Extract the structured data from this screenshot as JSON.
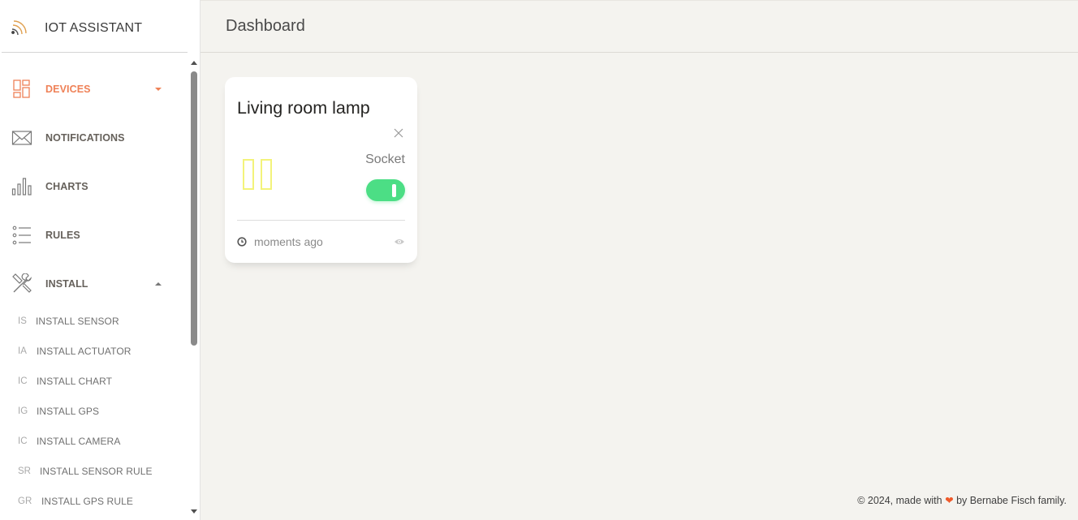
{
  "app": {
    "name": "IOT ASSISTANT"
  },
  "colors": {
    "accent": "#ef8157",
    "toggle_on": "#4cde85",
    "lamp_icon": "#f3f37a"
  },
  "sidebar": {
    "items": [
      {
        "label": "DEVICES",
        "icon": "dashboard-grid-icon",
        "active": true,
        "caret": "down"
      },
      {
        "label": "NOTIFICATIONS",
        "icon": "envelope-icon"
      },
      {
        "label": "CHARTS",
        "icon": "bar-chart-icon"
      },
      {
        "label": "RULES",
        "icon": "list-icon"
      },
      {
        "label": "INSTALL",
        "icon": "tools-icon",
        "caret": "up"
      }
    ],
    "install_items": [
      {
        "abbr": "IS",
        "label": "INSTALL SENSOR"
      },
      {
        "abbr": "IA",
        "label": "INSTALL ACTUATOR"
      },
      {
        "abbr": "IC",
        "label": "INSTALL CHART"
      },
      {
        "abbr": "IG",
        "label": "INSTALL GPS"
      },
      {
        "abbr": "IC",
        "label": "INSTALL CAMERA"
      },
      {
        "abbr": "SR",
        "label": "INSTALL SENSOR RULE"
      },
      {
        "abbr": "GR",
        "label": "INSTALL GPS RULE"
      }
    ]
  },
  "header": {
    "title": "Dashboard"
  },
  "card": {
    "title": "Living room lamp",
    "type": "Socket",
    "toggle_on": true,
    "timestamp": "moments ago"
  },
  "footer": {
    "prefix": "© 2024, made with",
    "heart": "❤",
    "suffix": "by Bernabe Fisch family."
  }
}
